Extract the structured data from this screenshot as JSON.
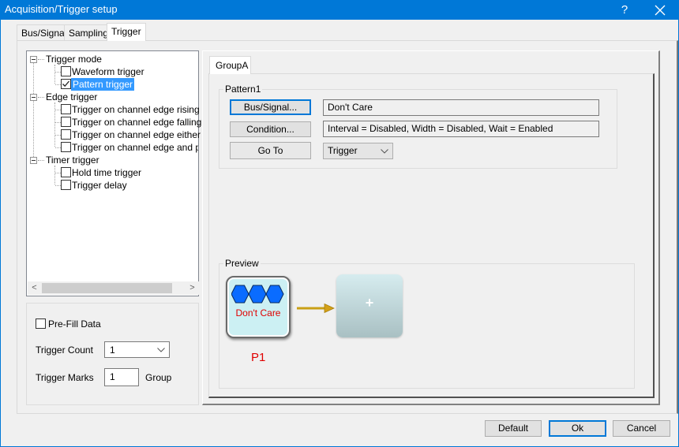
{
  "window": {
    "title": "Acquisition/Trigger setup",
    "help_label": "?",
    "close_icon": "close-icon",
    "accent_color": "#0078d7"
  },
  "tabs": [
    {
      "label": "Bus/Signal",
      "active": false
    },
    {
      "label": "Sampling",
      "active": false
    },
    {
      "label": "Trigger",
      "active": true
    }
  ],
  "tree": {
    "groups": [
      {
        "label": "Trigger mode",
        "expanded": true,
        "items": [
          {
            "label": "Waveform trigger",
            "checked": false,
            "selected": false
          },
          {
            "label": "Pattern trigger",
            "checked": true,
            "selected": true
          }
        ]
      },
      {
        "label": "Edge trigger",
        "expanded": true,
        "items": [
          {
            "label": "Trigger on channel edge rising",
            "checked": false
          },
          {
            "label": "Trigger on channel edge falling",
            "checked": false
          },
          {
            "label": "Trigger on channel edge either",
            "checked": false
          },
          {
            "label": "Trigger on channel edge and patt",
            "checked": false
          }
        ]
      },
      {
        "label": "Timer trigger",
        "expanded": true,
        "items": [
          {
            "label": "Hold time trigger",
            "checked": false
          },
          {
            "label": "Trigger delay",
            "checked": false
          }
        ]
      }
    ],
    "scroll_left": "<",
    "scroll_right": ">"
  },
  "options": {
    "prefill_label": "Pre-Fill Data",
    "prefill_checked": false,
    "trigger_count_label": "Trigger Count",
    "trigger_count_value": "1",
    "trigger_marks_label": "Trigger Marks",
    "trigger_marks_value": "1",
    "trigger_marks_unit": "Group"
  },
  "group_tab": {
    "label": "GroupA"
  },
  "pattern": {
    "title": "Pattern1",
    "bus_signal_button": "Bus/Signal...",
    "bus_signal_value": "Don't Care",
    "condition_button": "Condition...",
    "condition_value": "Interval = Disabled, Width = Disabled, Wait = Enabled",
    "goto_button": "Go To",
    "goto_value": "Trigger"
  },
  "preview": {
    "title": "Preview",
    "node_text": "Don't Care",
    "node_label": "P1",
    "add_label": "+",
    "node_label_color": "#e00000",
    "hexagon_color": "#0a6cff",
    "arrow_color": "#d4a017"
  },
  "footer": {
    "default_button": "Default",
    "ok_button": "Ok",
    "cancel_button": "Cancel"
  }
}
